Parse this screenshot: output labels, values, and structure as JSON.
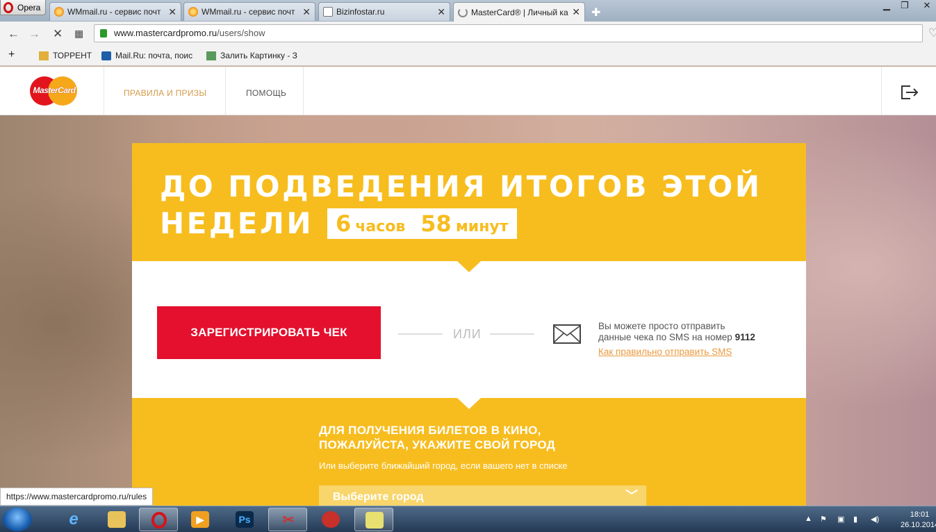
{
  "browser": {
    "menu_label": "Opera",
    "tabs": [
      {
        "title": "WMmail.ru - сервис почт",
        "icon": "wmmail-favicon"
      },
      {
        "title": "WMmail.ru - сервис почт",
        "icon": "wmmail-favicon"
      },
      {
        "title": "Bizinfostar.ru",
        "icon": "page-favicon"
      },
      {
        "title": "MasterCard® | Личный ка",
        "icon": "loading-spinner"
      }
    ],
    "url_host": "www.mastercardpromo.ru",
    "url_path": "/users/show",
    "bookmarks": [
      {
        "label": "ТОРРЕНТ"
      },
      {
        "label": "Mail.Ru: почта, поис"
      },
      {
        "label": "Залить Картинку - З"
      }
    ]
  },
  "site": {
    "logo_text": "MasterCard",
    "nav": {
      "rules": "ПРАВИЛА И ПРИЗЫ",
      "help": "ПОМОЩЬ"
    },
    "headline_line1": "ДО ПОДВЕДЕНИЯ ИТОГОВ ЭТОЙ",
    "headline_line2": "НЕДЕЛИ",
    "timer": {
      "hours": "6",
      "hours_unit": "часов",
      "minutes": "58",
      "minutes_unit": "минут"
    },
    "register_button": "ЗАРЕГИСТРИРОВАТЬ ЧЕК",
    "or_label": "ИЛИ",
    "sms_text_line1": "Вы можете просто отправить",
    "sms_text_line2": "данные чека по SMS на номер",
    "sms_number": "9112",
    "sms_link": "Как правильно отправить SMS",
    "city_title_line1": "ДЛЯ ПОЛУЧЕНИЯ БИЛЕТОВ В КИНО,",
    "city_title_line2": "ПОЖАЛУЙСТА, УКАЖИТЕ СВОЙ ГОРОД",
    "city_subtitle": "Или выберите ближайший город, если вашего нет в списке",
    "city_select_placeholder": "Выберите город"
  },
  "status_bar_url": "https://www.mastercardpromo.ru/rules",
  "taskbar": {
    "clock_time": "18:01",
    "clock_date": "26.10.2014",
    "ps_label": "Ps"
  },
  "colors": {
    "yellow": "#f7bd1f",
    "red_button": "#e4102e",
    "link_orange": "#e89a3e"
  }
}
